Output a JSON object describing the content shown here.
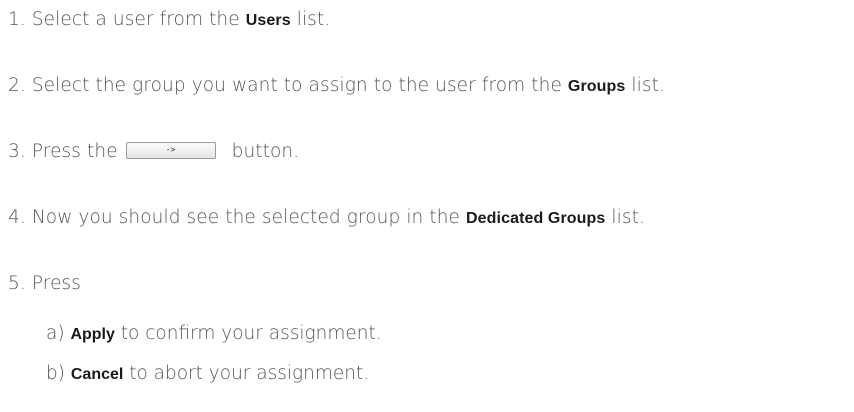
{
  "steps": [
    {
      "num": "1.",
      "pre": "Select a user from the ",
      "kw": "Users",
      "post": " list."
    },
    {
      "num": "2.",
      "pre": "Select the group you want to assign to the user from the ",
      "kw": "Groups",
      "post": " list."
    },
    {
      "num": "3.",
      "pre": "Press the ",
      "button_label": "->",
      "post": " button."
    },
    {
      "num": "4.",
      "pre": "Now you should see the selected group in the ",
      "kw": "Dedicated Groups",
      "post": " list."
    },
    {
      "num": "5.",
      "text": "Press"
    }
  ],
  "substeps": [
    {
      "letter": "a)",
      "kw": "Apply",
      "post": " to confirm your assignment."
    },
    {
      "letter": "b)",
      "kw": "Cancel",
      "post": " to abort your assignment."
    }
  ]
}
